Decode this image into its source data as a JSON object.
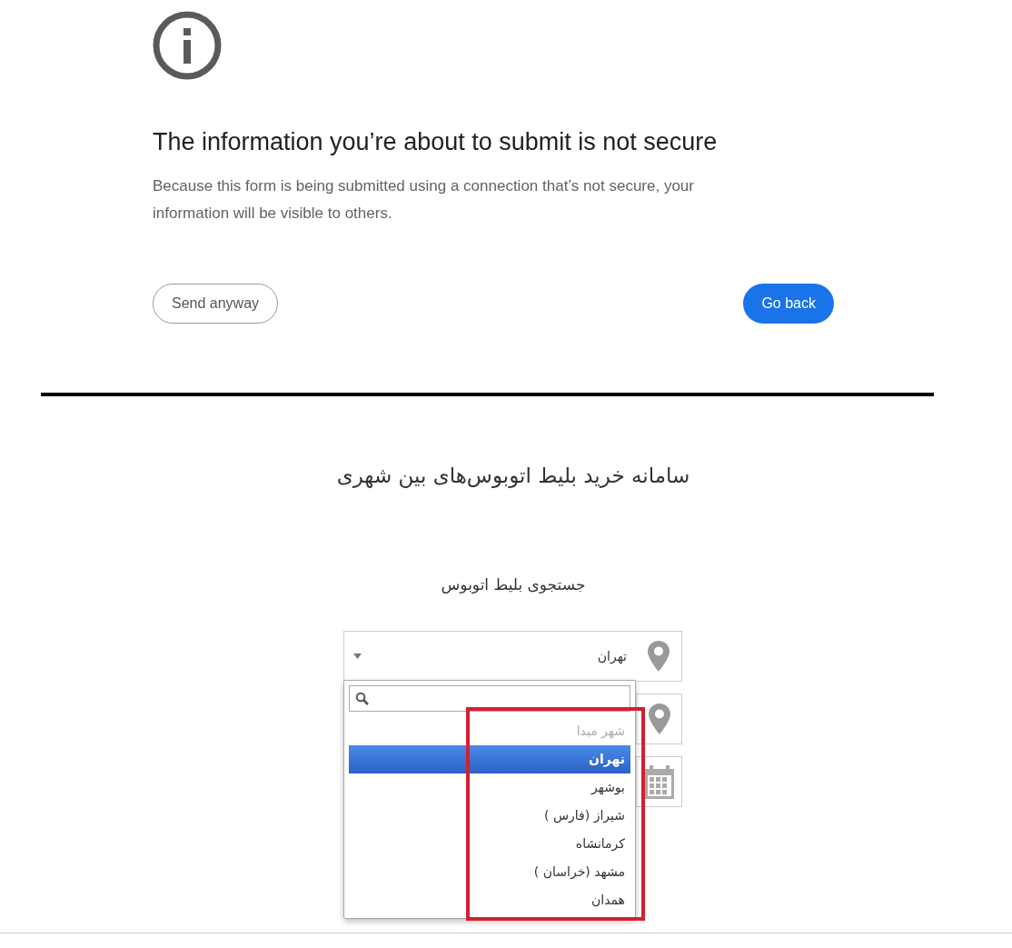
{
  "dialog": {
    "title": "The information you’re about to submit is not secure",
    "message": "Because this form is being submitted using a connection that’s not secure, your information will be visible to others.",
    "secondary_button": {
      "label": "Send anyway"
    },
    "primary_button": {
      "label": "Go back"
    }
  },
  "page": {
    "title": "سامانه خرید بلیط اتوبوس‌های بین شهری",
    "subtitle": "جستجوی بلیط اتوبوس"
  },
  "origin_select": {
    "value": "تهران",
    "expanded": true
  },
  "other_fields": [
    {
      "kind": "place"
    },
    {
      "kind": "date"
    }
  ],
  "dropdown": {
    "options": [
      {
        "label": "شهر مبدا",
        "disabled": true,
        "selected": false
      },
      {
        "label": "تهران",
        "disabled": false,
        "selected": true
      },
      {
        "label": "بوشهر",
        "disabled": false,
        "selected": false
      },
      {
        "label": "شیراز (فارس )",
        "disabled": false,
        "selected": false
      },
      {
        "label": "کرمانشاه",
        "disabled": false,
        "selected": false
      },
      {
        "label": "مشهد (خراسان )",
        "disabled": false,
        "selected": false
      },
      {
        "label": "همدان",
        "disabled": false,
        "selected": false
      }
    ]
  }
}
